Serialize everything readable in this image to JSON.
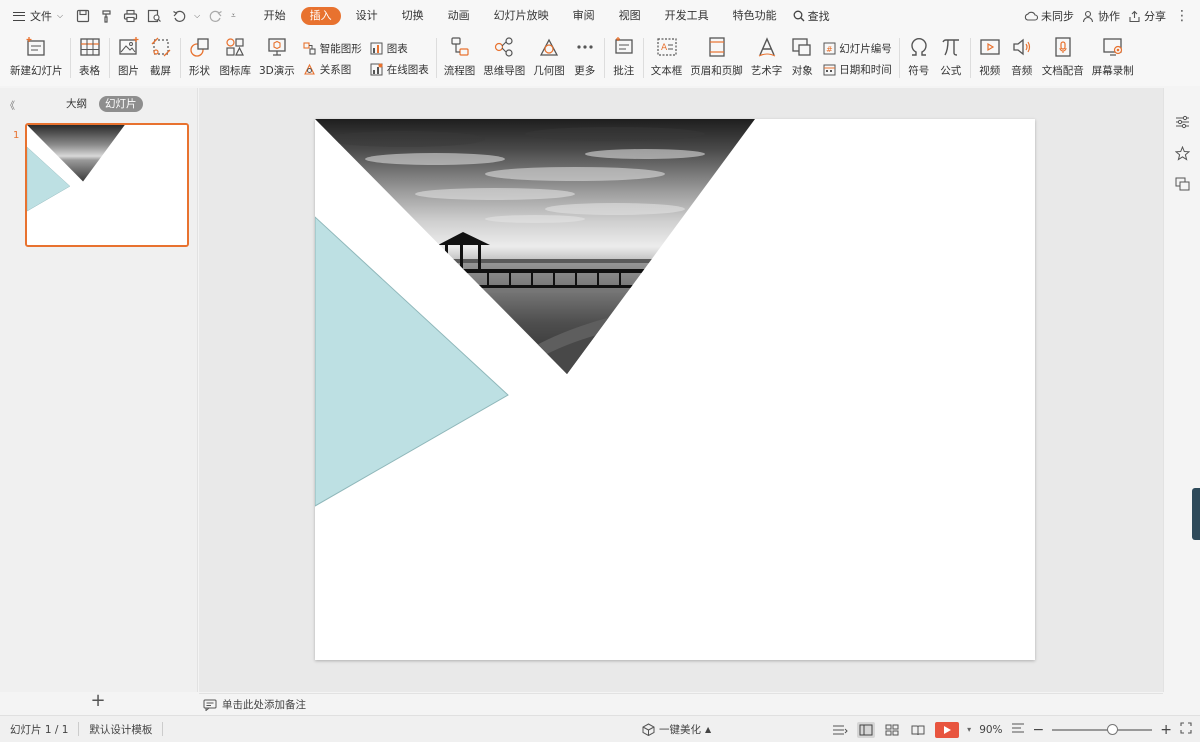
{
  "menubar": {
    "file_label": "文件",
    "tabs": [
      {
        "label": "开始",
        "active": false
      },
      {
        "label": "插入",
        "active": true
      },
      {
        "label": "设计",
        "active": false
      },
      {
        "label": "切换",
        "active": false
      },
      {
        "label": "动画",
        "active": false
      },
      {
        "label": "幻灯片放映",
        "active": false
      },
      {
        "label": "审阅",
        "active": false
      },
      {
        "label": "视图",
        "active": false
      },
      {
        "label": "开发工具",
        "active": false
      },
      {
        "label": "特色功能",
        "active": false
      }
    ],
    "search_label": "查找",
    "sync_label": "未同步",
    "collab_label": "协作",
    "share_label": "分享"
  },
  "ribbon": {
    "new_slide": "新建幻灯片",
    "table": "表格",
    "picture": "图片",
    "screenshot": "截屏",
    "shape": "形状",
    "icon_lib": "图标库",
    "demo3d": "3D演示",
    "smart_art": "智能图形",
    "relation": "关系图",
    "chart": "图表",
    "online_chart": "在线图表",
    "flowchart": "流程图",
    "mindmap": "思维导图",
    "geometry": "几何图",
    "more": "更多",
    "comment": "批注",
    "textbox": "文本框",
    "header_footer": "页眉和页脚",
    "wordart": "艺术字",
    "object": "对象",
    "slide_number": "幻灯片编号",
    "datetime": "日期和时间",
    "symbol": "符号",
    "formula": "公式",
    "video": "视频",
    "audio": "音频",
    "doc_dub": "文档配音",
    "screen_record": "屏幕录制"
  },
  "leftpanel": {
    "tab_outline": "大纲",
    "tab_slides": "幻灯片",
    "thumb_number": "1"
  },
  "notes": {
    "placeholder": "单击此处添加备注"
  },
  "statusbar": {
    "slide_info": "幻灯片 1 / 1",
    "template": "默认设计模板",
    "beautify": "一键美化",
    "zoom": "90%",
    "zoom_fraction": 0.6
  },
  "colors": {
    "accent": "#e8722f",
    "teal_triangle": "#bde0e3",
    "teal_stroke": "#8fb7ba"
  }
}
